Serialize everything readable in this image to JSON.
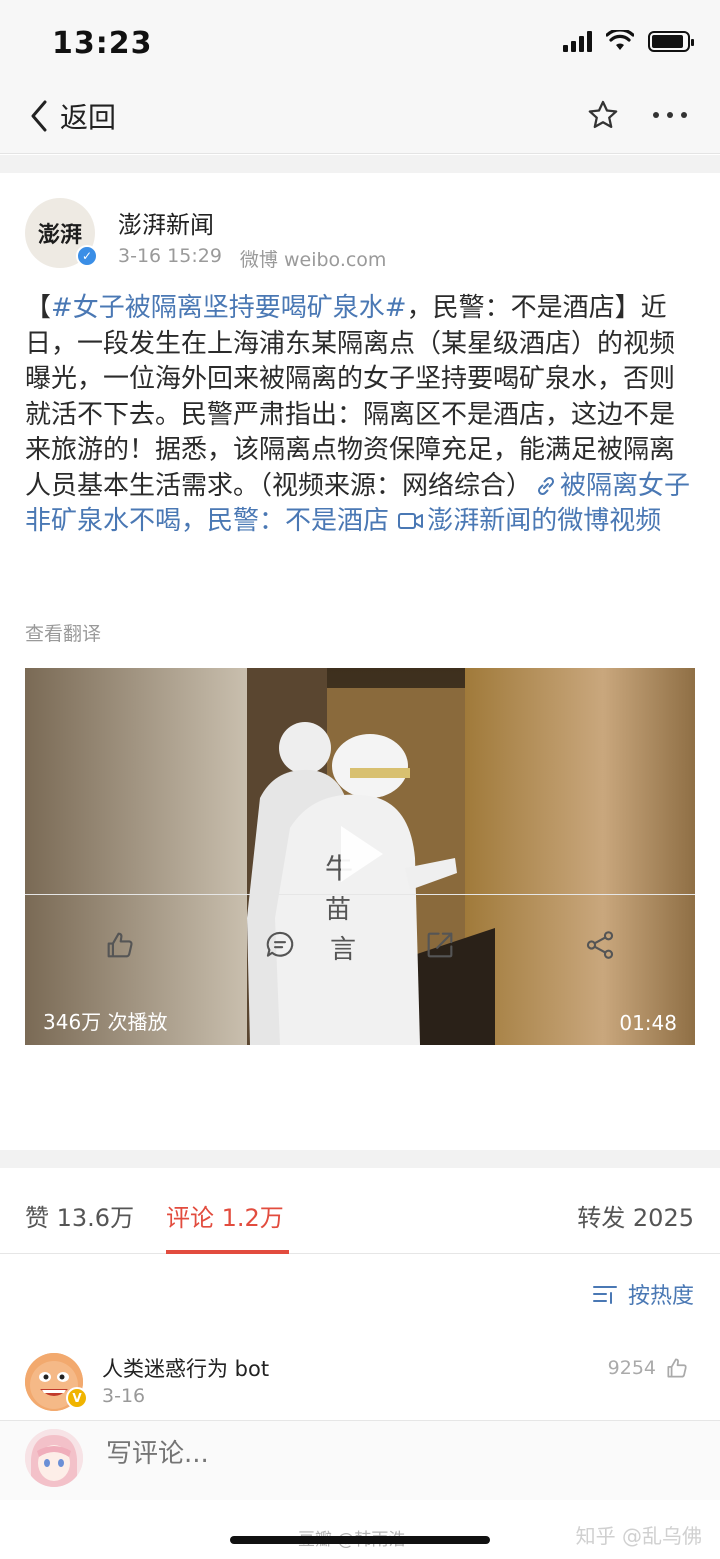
{
  "status_bar": {
    "time": "13:23"
  },
  "nav": {
    "back_label": "返回"
  },
  "post": {
    "avatar_text": "澎湃",
    "author": "澎湃新闻",
    "date": "3-16 15:29",
    "source": "微博 weibo.com",
    "text_title_bracket_open": "【",
    "text_hashtag": "#女子被隔离坚持要喝矿泉水#",
    "text_after_hashtag": "，民警：不是酒店】近日，一段发生在上海浦东某隔离点（某星级酒店）的视频曝光，一位海外回来被隔离的女子坚持要喝矿泉水，否则就活不下去。民警严肃指出：隔离区不是酒店，这边不是来旅游的！据悉，该隔离点物资保障充足，能满足被隔离人员基本生活需求。（视频来源：网络综合）",
    "link_text": "被隔离女子非矿泉水不喝，民警：不是酒店",
    "video_link_text": "澎湃新闻的微博视频",
    "translate": "查看翻译"
  },
  "video": {
    "plays": "346万 次播放",
    "duration": "01:48"
  },
  "tabs": {
    "likes": "赞 13.6万",
    "comments": "评论 1.2万",
    "reposts": "转发 2025"
  },
  "sort": {
    "label": "按热度"
  },
  "comment": {
    "name": "人类迷惑行为 bot",
    "time": "3-16",
    "likes": "9254"
  },
  "compose": {
    "placeholder": "写评论..."
  },
  "watermarks": {
    "left": "豆瓣  @韩雨浩",
    "right": "知乎 @乱乌佛"
  }
}
